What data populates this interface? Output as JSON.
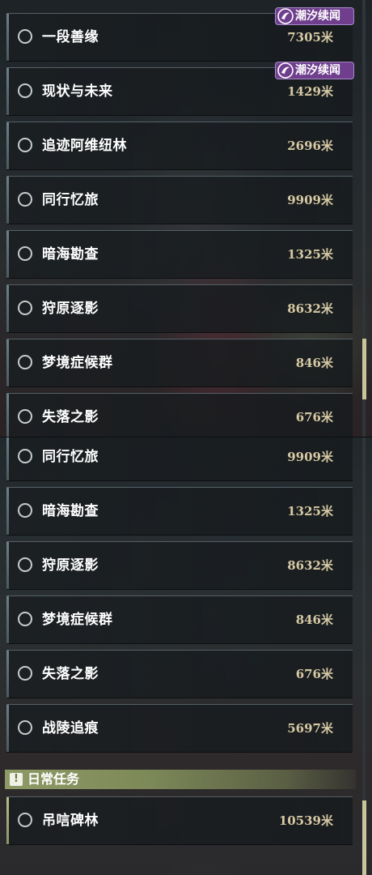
{
  "badge": {
    "label": "潮汐续闻"
  },
  "panel_top": {
    "tasks": [
      {
        "name": "一段善缘",
        "distance": "7305米"
      },
      {
        "name": "现状与未来",
        "distance": "1429米"
      },
      {
        "name": "追迹阿维纽林",
        "distance": "2696米"
      },
      {
        "name": "同行忆旅",
        "distance": "9909米"
      },
      {
        "name": "暗海勘查",
        "distance": "1325米"
      },
      {
        "name": "狩原逐影",
        "distance": "8632米"
      },
      {
        "name": "梦境症候群",
        "distance": "846米"
      },
      {
        "name": "失落之影",
        "distance": "676米"
      }
    ]
  },
  "panel_bottom": {
    "tasks": [
      {
        "name": "同行忆旅",
        "distance": "9909米"
      },
      {
        "name": "暗海勘查",
        "distance": "1325米"
      },
      {
        "name": "狩原逐影",
        "distance": "8632米"
      },
      {
        "name": "梦境症候群",
        "distance": "846米"
      },
      {
        "name": "失落之影",
        "distance": "676米"
      },
      {
        "name": "战陵追痕",
        "distance": "5697米"
      }
    ],
    "daily_section": {
      "icon": "alert-icon",
      "icon_glyph": "!",
      "title": "日常任务",
      "tasks": [
        {
          "name": "吊唁碑林",
          "distance": "10539米"
        }
      ]
    }
  },
  "colors": {
    "distance_text": "#d6c9a4",
    "section_bar": "#8e9a66",
    "badge_bg": "#6f3f8d",
    "scroll_thumb": "#c9c59a"
  }
}
